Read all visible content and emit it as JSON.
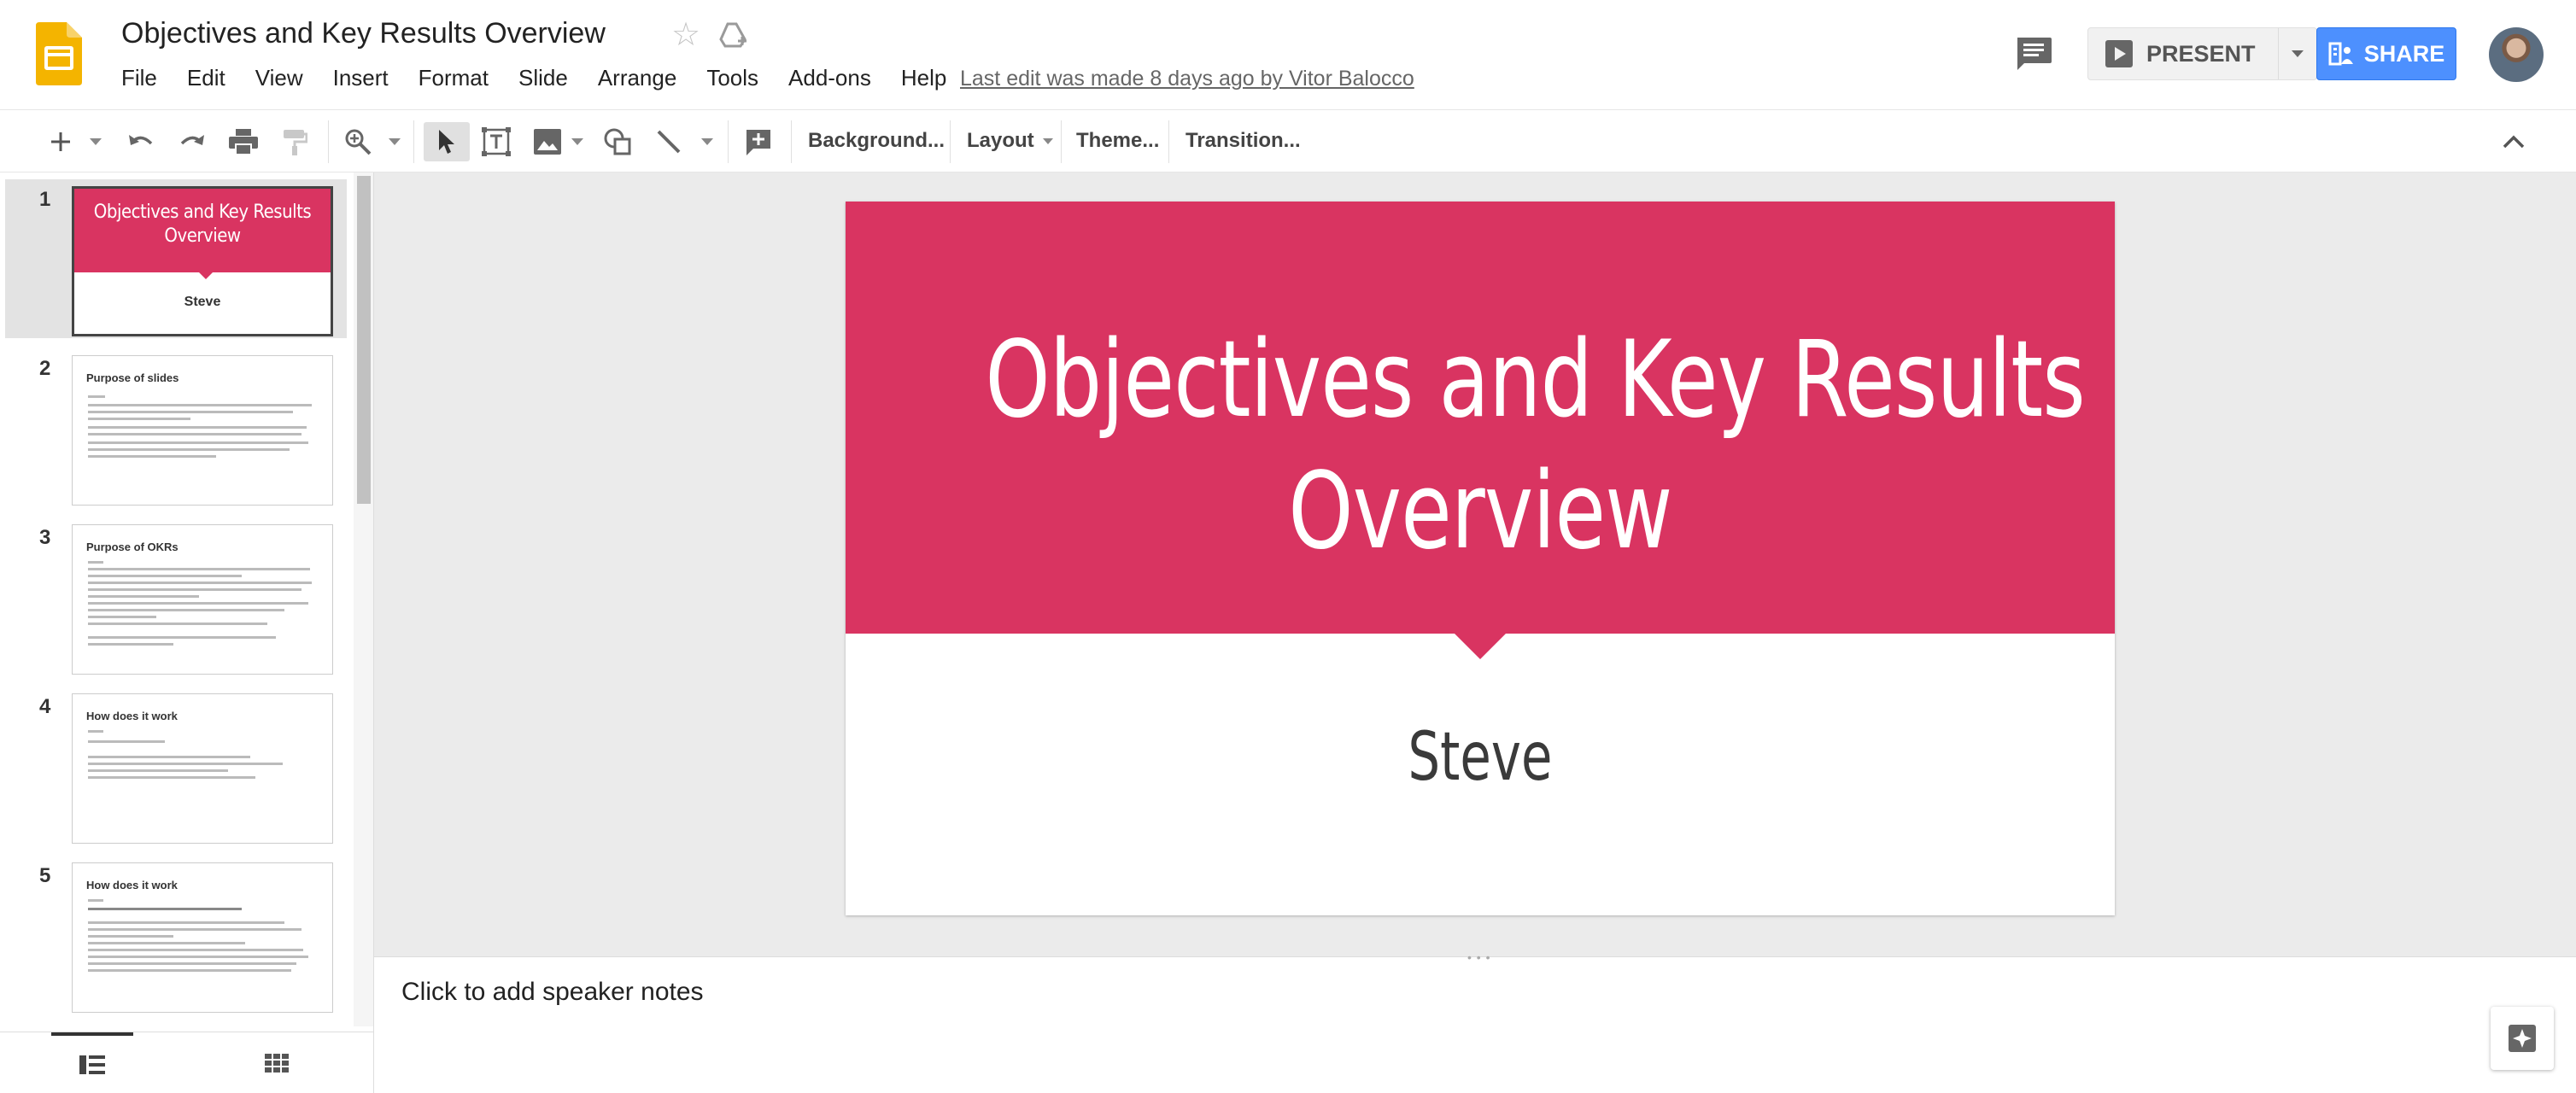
{
  "doc": {
    "title": "Objectives and Key Results Overview",
    "last_edit": "Last edit was made 8 days ago by Vitor Balocco"
  },
  "menu": [
    "File",
    "Edit",
    "View",
    "Insert",
    "Format",
    "Slide",
    "Arrange",
    "Tools",
    "Add-ons",
    "Help"
  ],
  "header": {
    "present_label": "PRESENT",
    "share_label": "SHARE",
    "brand_color": "#f4b400",
    "share_color": "#4d90fe"
  },
  "toolbar": {
    "background_label": "Background...",
    "layout_label": "Layout",
    "theme_label": "Theme...",
    "transition_label": "Transition..."
  },
  "slides": [
    {
      "num": "1",
      "title": "Objectives and Key Results Overview",
      "subtitle": "Steve",
      "selected": true
    },
    {
      "num": "2",
      "title": "Purpose of slides"
    },
    {
      "num": "3",
      "title": "Purpose of OKRs"
    },
    {
      "num": "4",
      "title": "How does it work"
    },
    {
      "num": "5",
      "title": "How does it work"
    }
  ],
  "current_slide": {
    "title_line1": "Objectives and Key Results",
    "title_line2": "Overview",
    "subtitle": "Steve",
    "accent_color": "#d93461"
  },
  "notes": {
    "placeholder": "Click to add speaker notes"
  }
}
